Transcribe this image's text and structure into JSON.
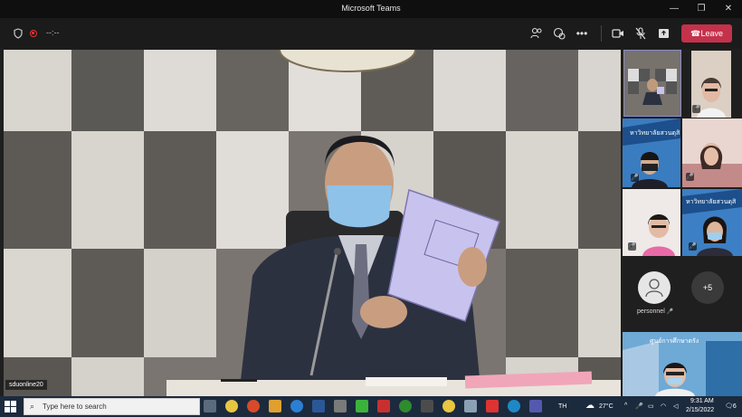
{
  "window": {
    "title": "Microsoft Teams",
    "minimize_icon": "minimize-icon",
    "maximize_icon": "maximize-icon",
    "close_icon": "close-icon"
  },
  "toolbar": {
    "timer": "--:--",
    "leave_label": "Leave",
    "icons": [
      "shield-icon",
      "record-icon",
      "participants-icon",
      "chat-icon",
      "more-icon",
      "camera-icon",
      "mic-off-icon",
      "share-icon",
      "phone-icon"
    ],
    "leave_color": "#c4314b"
  },
  "main_video": {
    "name_label": "sduonline20"
  },
  "participants": {
    "personnel_name": "personnel",
    "more_count": "+5"
  },
  "taskbar": {
    "search_placeholder": "Type here to search",
    "language": "TH",
    "weather": "27°C",
    "time": "9:31 AM",
    "date": "2/15/2022",
    "notification_count": "6"
  }
}
